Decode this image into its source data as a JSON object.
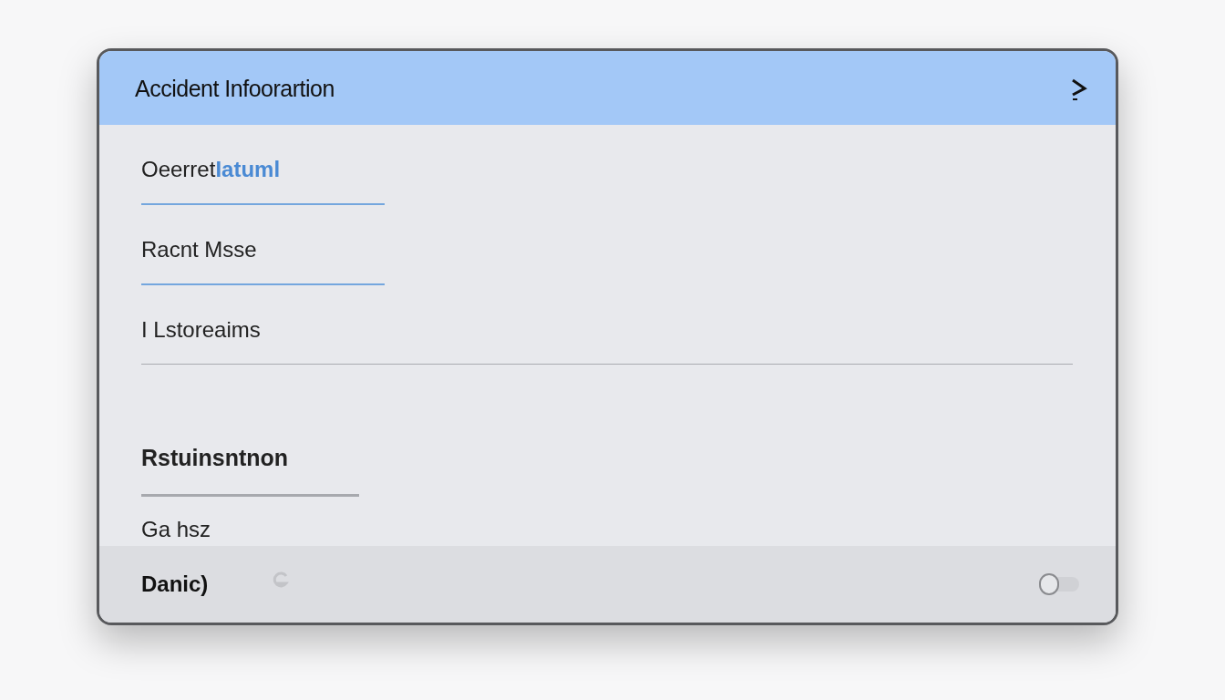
{
  "header": {
    "title": "Accident Infoorartion"
  },
  "fields": [
    {
      "label": "Oeerret",
      "value": "Iatuml"
    },
    {
      "label": "Racnt Msse"
    },
    {
      "label": "I Lstoreaims"
    }
  ],
  "section": {
    "title": "Rstuinsntnon",
    "fields": [
      {
        "label": "Ga hsz"
      }
    ]
  },
  "footer": {
    "label": "Danic)",
    "toggle": {
      "on": false
    }
  }
}
